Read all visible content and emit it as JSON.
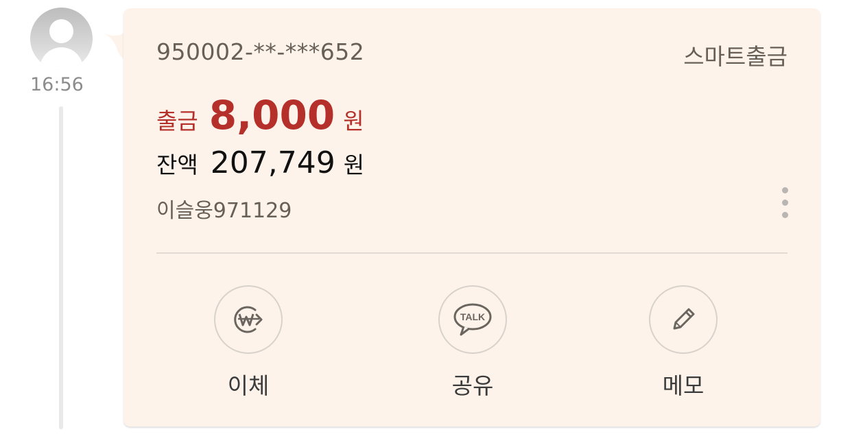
{
  "message": {
    "time": "16:56"
  },
  "card": {
    "account": "950002-**-***652",
    "type": "스마트출금",
    "withdraw": {
      "label": "출금",
      "amount": "8,000",
      "unit": "원"
    },
    "balance": {
      "label": "잔액",
      "amount": "207,749",
      "unit": "원"
    },
    "memo_name": "이슬웅971129"
  },
  "actions": [
    {
      "label": "이체",
      "icon": "won-transfer-icon"
    },
    {
      "label": "공유",
      "icon": "talk-bubble-icon",
      "icon_text": "TALK"
    },
    {
      "label": "메모",
      "icon": "pencil-icon"
    }
  ],
  "colors": {
    "card_bg": "#fdf3ea",
    "accent_red": "#b5302a",
    "muted_text": "#666058"
  }
}
